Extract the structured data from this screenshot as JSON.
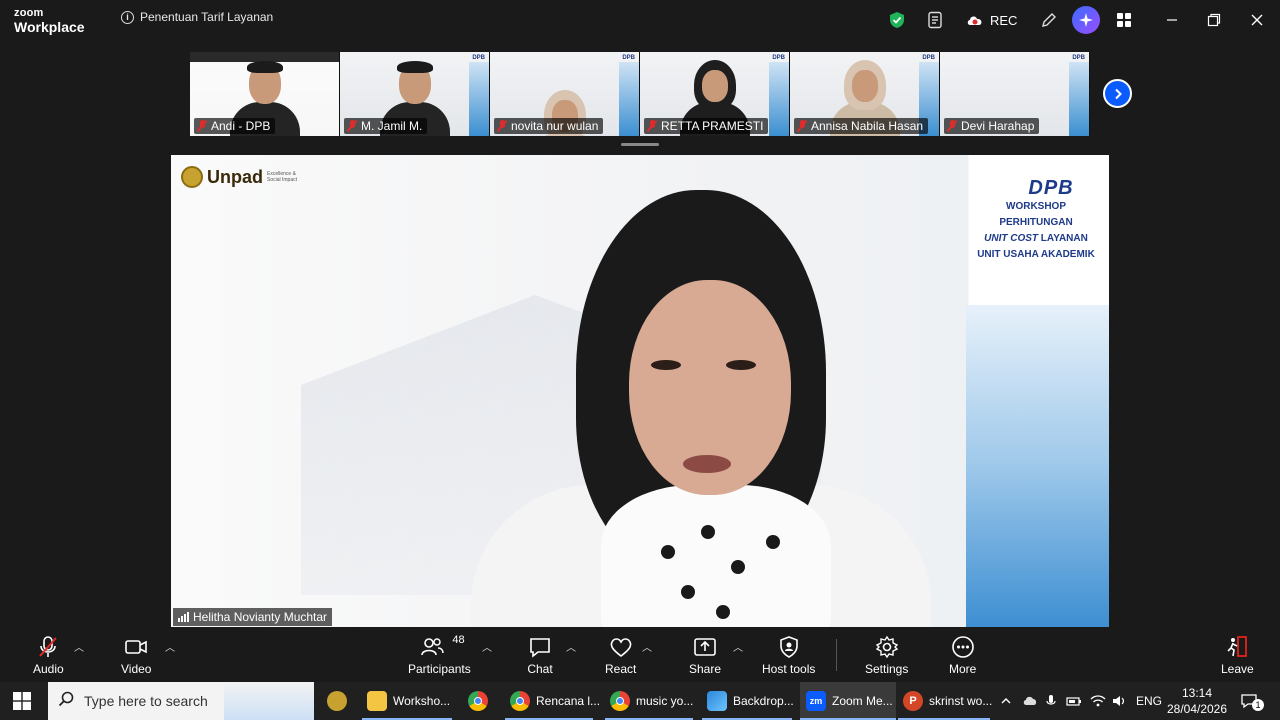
{
  "titlebar": {
    "brand_top": "zoom",
    "brand_bottom": "Workplace",
    "meeting_title": "Penentuan Tarif Layanan",
    "rec_label": "REC"
  },
  "filmstrip": {
    "participants": [
      {
        "name": "Andi - DPB"
      },
      {
        "name": "M. Jamil M."
      },
      {
        "name": "novita nur wulan"
      },
      {
        "name": "RETTA PRAMESTI"
      },
      {
        "name": "Annisa Nabila Hasan"
      },
      {
        "name": "Devi Harahap"
      }
    ]
  },
  "main_video": {
    "speaker_name": "Helitha Novianty Muchtar",
    "logo_text": "Unpad",
    "logo_sub": "Excellence & Social Impact",
    "banner": {
      "logo": "DPB",
      "line1": "WORKSHOP",
      "line2": "PERHITUNGAN",
      "line3_italic": "UNIT COST",
      "line3_rest": " LAYANAN",
      "line4": "UNIT USAHA AKADEMIK"
    }
  },
  "toolbar": {
    "audio": "Audio",
    "video": "Video",
    "participants": "Participants",
    "participants_count": "48",
    "chat": "Chat",
    "react": "React",
    "share": "Share",
    "host_tools": "Host tools",
    "settings": "Settings",
    "more": "More",
    "leave": "Leave"
  },
  "taskbar": {
    "search_placeholder": "Type here to search",
    "apps": [
      {
        "label": "Worksho...",
        "icon": "folder-icon"
      },
      {
        "label": "",
        "icon": "chrome-icon"
      },
      {
        "label": "Rencana l...",
        "icon": "chrome-icon"
      },
      {
        "label": "music yo...",
        "icon": "chrome-icon"
      },
      {
        "label": "Backdrop...",
        "icon": "paint-icon"
      },
      {
        "label": "Zoom Me...",
        "icon": "zoom-icon"
      },
      {
        "label": "skrinst wo...",
        "icon": "powerpoint-icon"
      }
    ],
    "language": "ENG",
    "time": "13:14",
    "date": "28/04/2026",
    "notification_count": "1"
  },
  "colors": {
    "accent_blue": "#0b5cff",
    "mute_red": "#e02b2b",
    "leave_red": "#e0241b"
  }
}
